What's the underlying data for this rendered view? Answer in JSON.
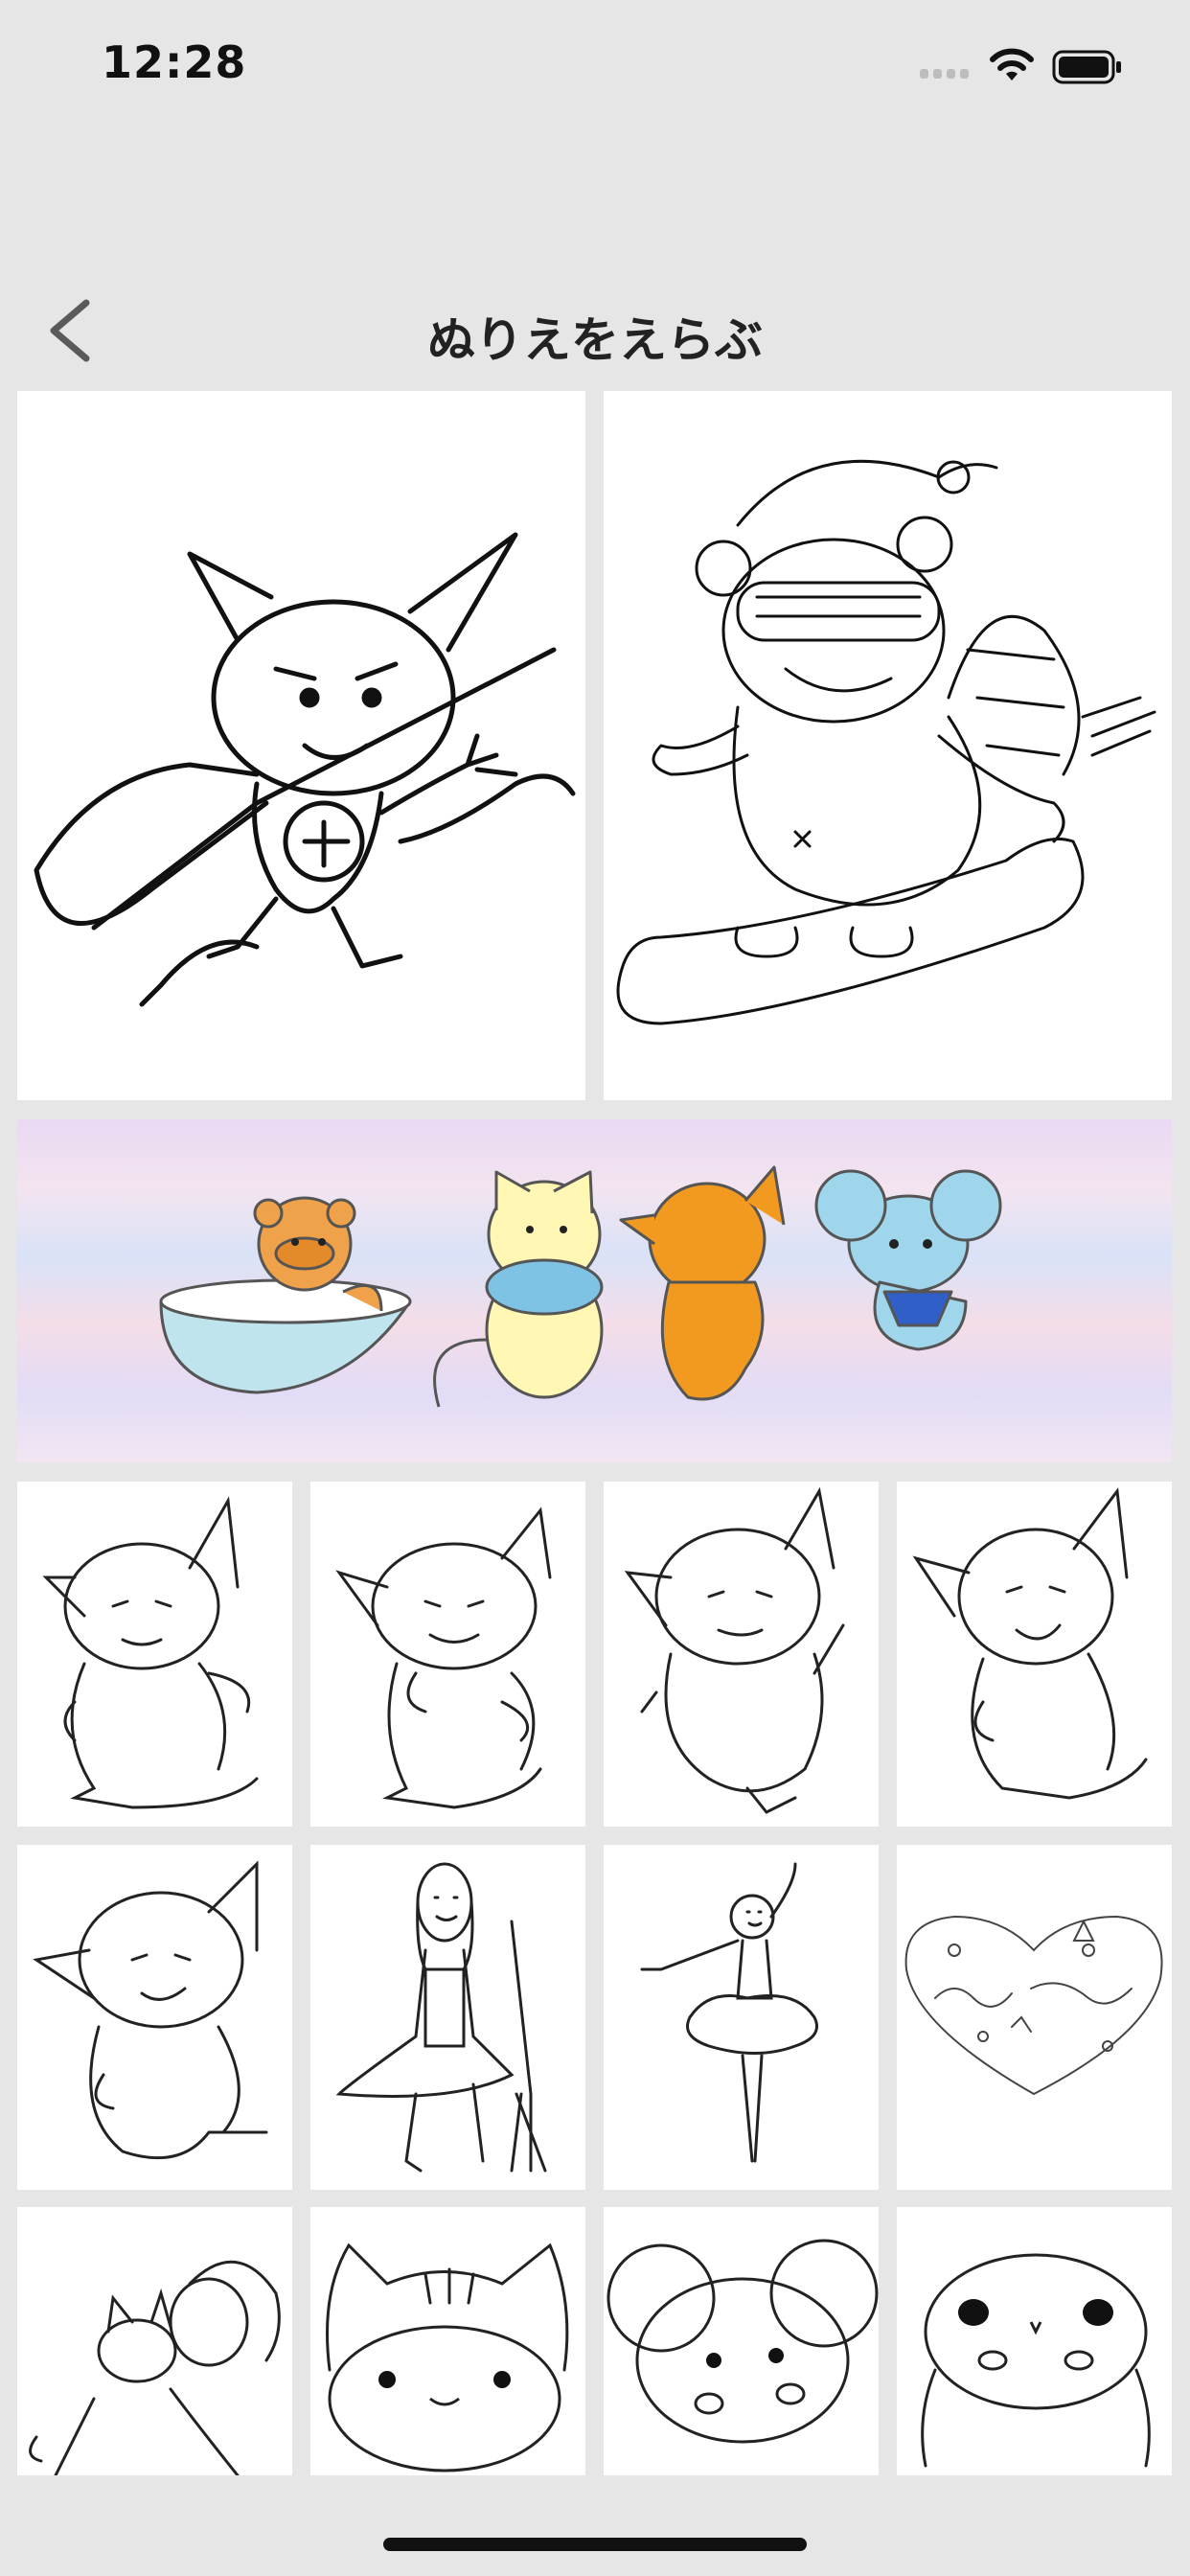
{
  "status_bar": {
    "time": "12:28",
    "signal_icon": "signal-icon",
    "wifi_icon": "wifi-icon",
    "battery_icon": "battery-icon"
  },
  "nav": {
    "title": "ぬりえをえらぶ",
    "back_icon": "chevron-left-icon"
  },
  "grid": {
    "banner_label": "colored-characters-banner",
    "items": [
      "cat-warrior-sketch",
      "tanuki-snowboard-sketch",
      "cat-dance-1-sketch",
      "cat-dance-2-sketch",
      "cat-dance-3-sketch",
      "cat-dance-4-sketch",
      "cat-dance-5-sketch",
      "girl-broom-sketch",
      "ballerina-sketch",
      "happy-birthday-heart-sketch",
      "girl-hugging-cat-sketch",
      "striped-cat-sketch",
      "mouse-sketch",
      "round-creature-sketch"
    ]
  },
  "colors": {
    "background": "#e6e6e6",
    "tile": "#ffffff",
    "ink": "#111111"
  }
}
